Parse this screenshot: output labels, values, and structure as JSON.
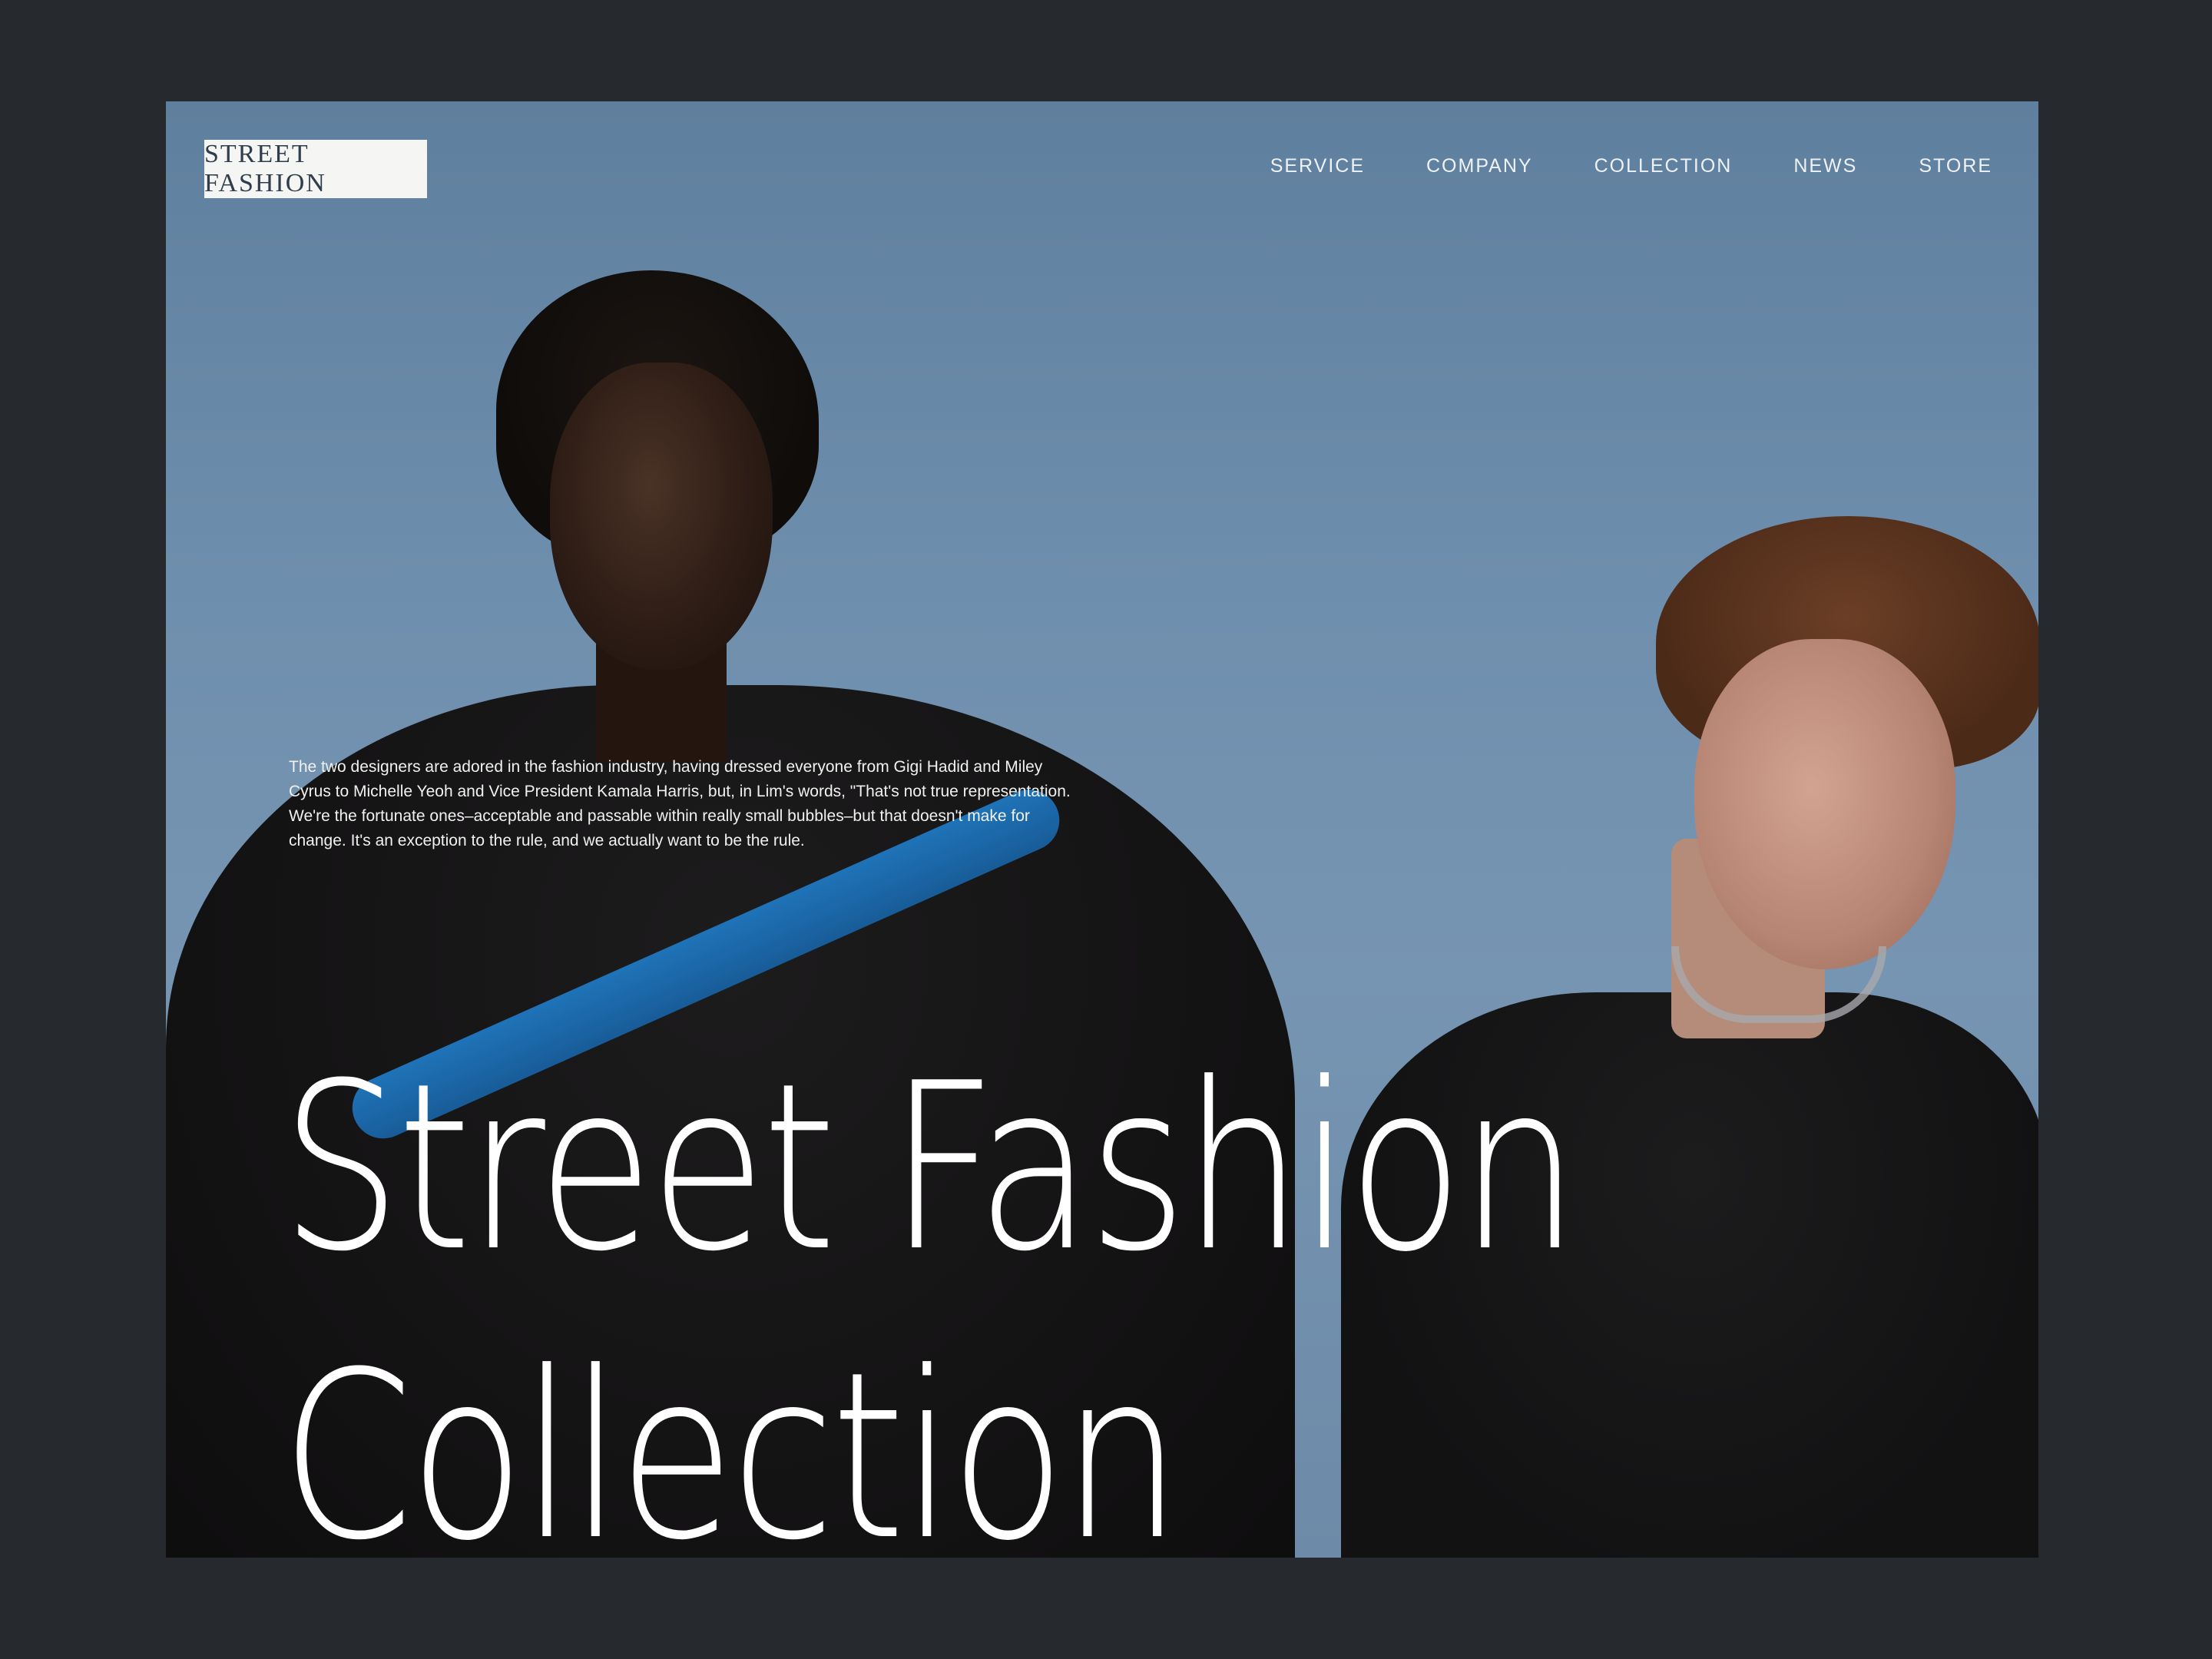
{
  "header": {
    "logo_text": "STREET FASHION",
    "nav": [
      "SERVICE",
      "COMPANY",
      "COLLECTION",
      "NEWS",
      "STORE"
    ]
  },
  "hero": {
    "blurb": "The two designers are adored in the fashion industry, having dressed everyone from Gigi Hadid and Miley Cyrus to Michelle Yeoh and Vice President Kamala Harris, but, in Lim's words, \"That's not true representation. We're the fortunate ones–acceptable and passable within really small bubbles–but that doesn't make for change. It's an exception to the rule, and we actually want to be the rule.",
    "title_line1": "Street Fashion",
    "title_line2": "Collection"
  },
  "colors": {
    "page_background": "#262a2f",
    "sky": "#6f8fae",
    "accent_blue": "#1e6fb3"
  }
}
